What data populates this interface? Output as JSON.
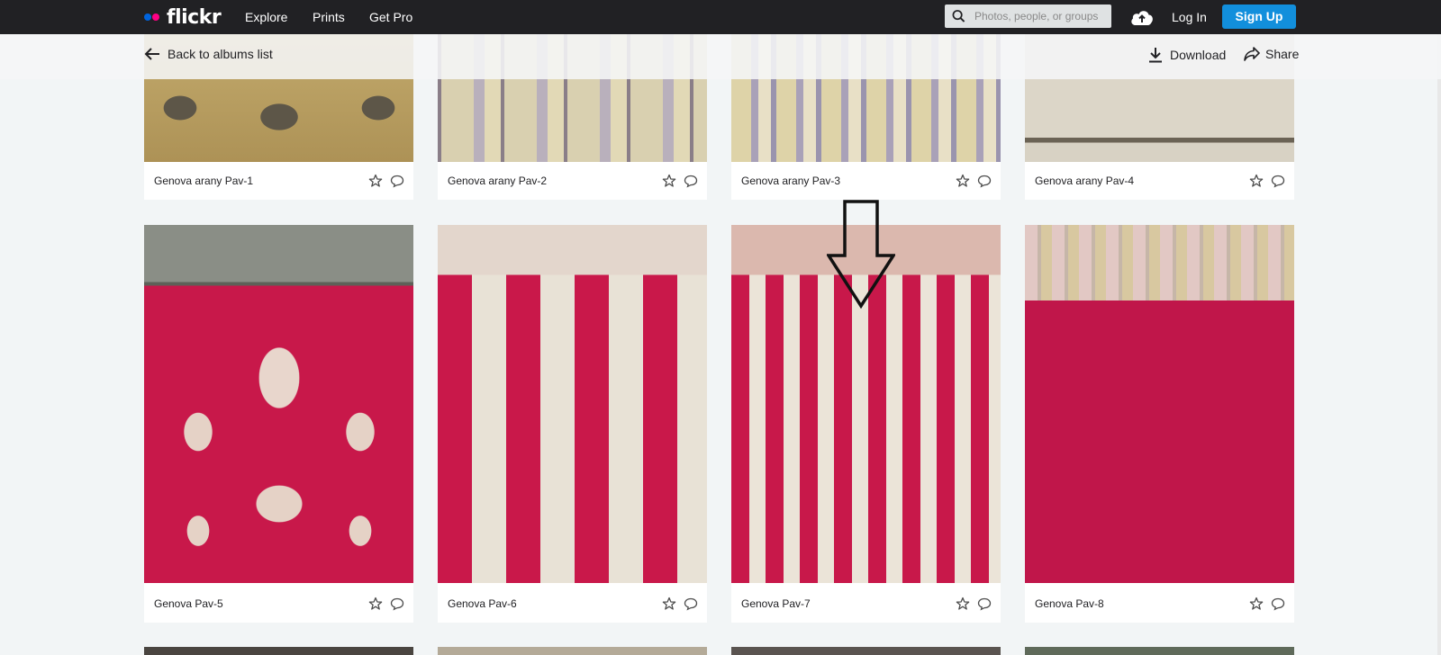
{
  "app": {
    "logo_text": "flickr",
    "dot_colors": [
      "#0063dc",
      "#ff0084"
    ]
  },
  "nav": {
    "explore": "Explore",
    "prints": "Prints",
    "get_pro": "Get Pro"
  },
  "search": {
    "placeholder": "Photos, people, or groups"
  },
  "auth": {
    "login": "Log In",
    "signup": "Sign Up",
    "signup_color": "#128fdc"
  },
  "subbar": {
    "back": "Back to albums list",
    "download": "Download",
    "share": "Share"
  },
  "photos": [
    {
      "title": "Genova arany Pav-1"
    },
    {
      "title": "Genova arany Pav-2"
    },
    {
      "title": "Genova arany Pav-3"
    },
    {
      "title": "Genova arany Pav-4"
    },
    {
      "title": "Genova Pav-5"
    },
    {
      "title": "Genova Pav-6"
    },
    {
      "title": "Genova Pav-7"
    },
    {
      "title": "Genova Pav-8"
    }
  ]
}
